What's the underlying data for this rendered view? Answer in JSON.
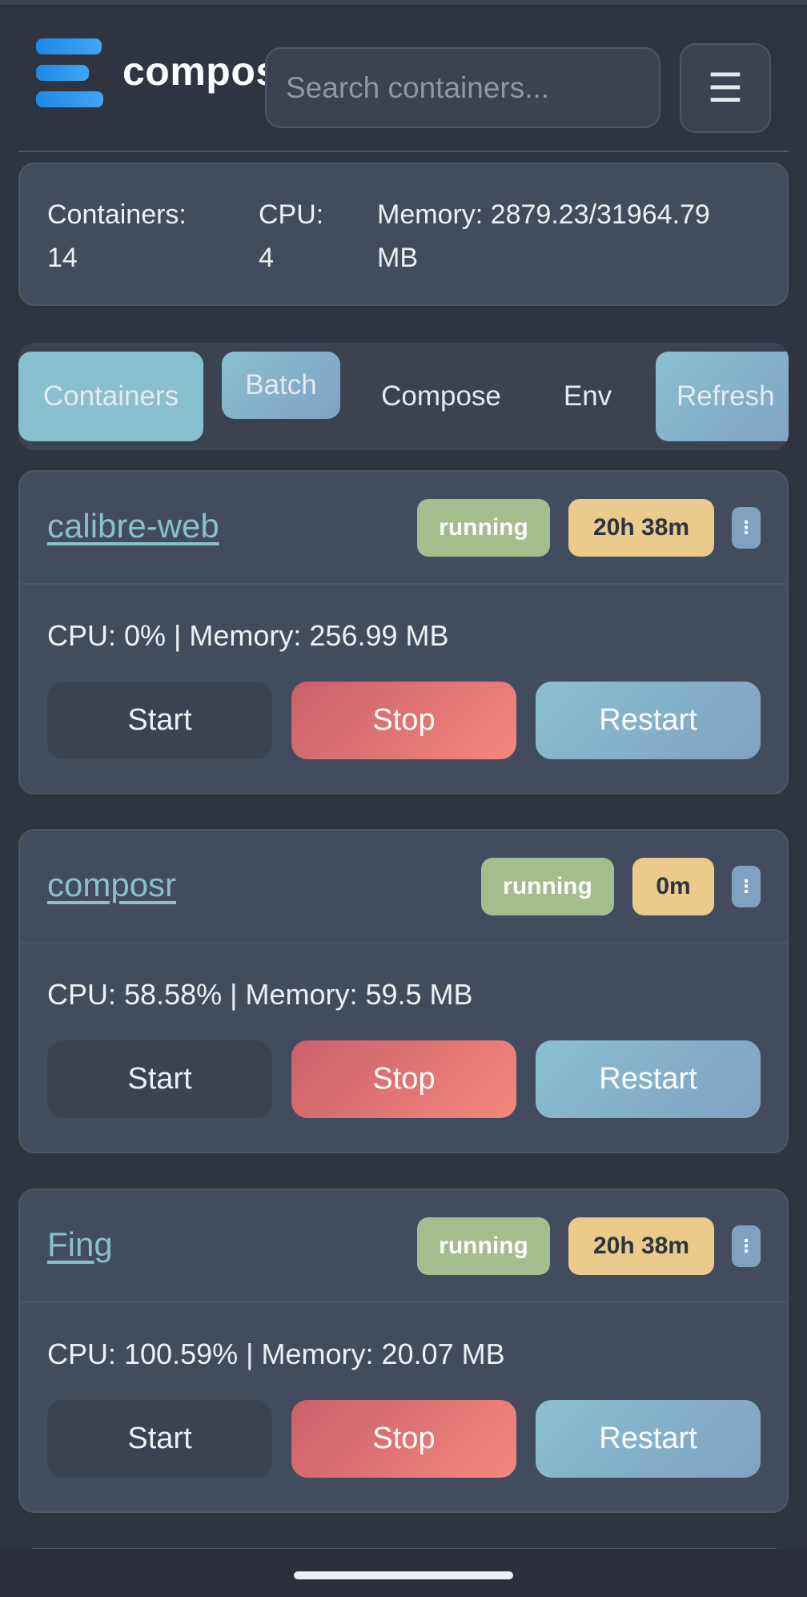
{
  "app": {
    "brand": "composr"
  },
  "search": {
    "placeholder": "Search containers..."
  },
  "menu": {
    "icon": "☰"
  },
  "stats": {
    "containers_label": "Containers:",
    "containers_value": "14",
    "cpu_label": "CPU:",
    "cpu_value": "4",
    "memory_label": "Memory: 2879.23/31964.79",
    "memory_unit": "MB"
  },
  "tabs": [
    {
      "label": "Containers"
    },
    {
      "label": "Batch"
    },
    {
      "label": "Compose"
    },
    {
      "label": "Env"
    },
    {
      "label": "Refresh"
    }
  ],
  "containers": [
    {
      "name": "calibre-web",
      "status": "running",
      "uptime": "20h 38m",
      "metrics": "CPU: 0% | Memory: 256.99 MB"
    },
    {
      "name": "composr",
      "status": "running",
      "uptime": "0m",
      "metrics": "CPU: 58.58% | Memory: 59.5 MB"
    },
    {
      "name": "Fing",
      "status": "running",
      "uptime": "20h 38m",
      "metrics": "CPU: 100.59% | Memory: 20.07 MB"
    }
  ],
  "actions": {
    "start": "Start",
    "stop": "Stop",
    "restart": "Restart",
    "more": "⋮"
  },
  "colors": {
    "accent": "#88c0d0",
    "running": "#a3be8c",
    "uptime": "#ebcb8b",
    "stop": "#bf616a",
    "background": "#2e3440"
  }
}
